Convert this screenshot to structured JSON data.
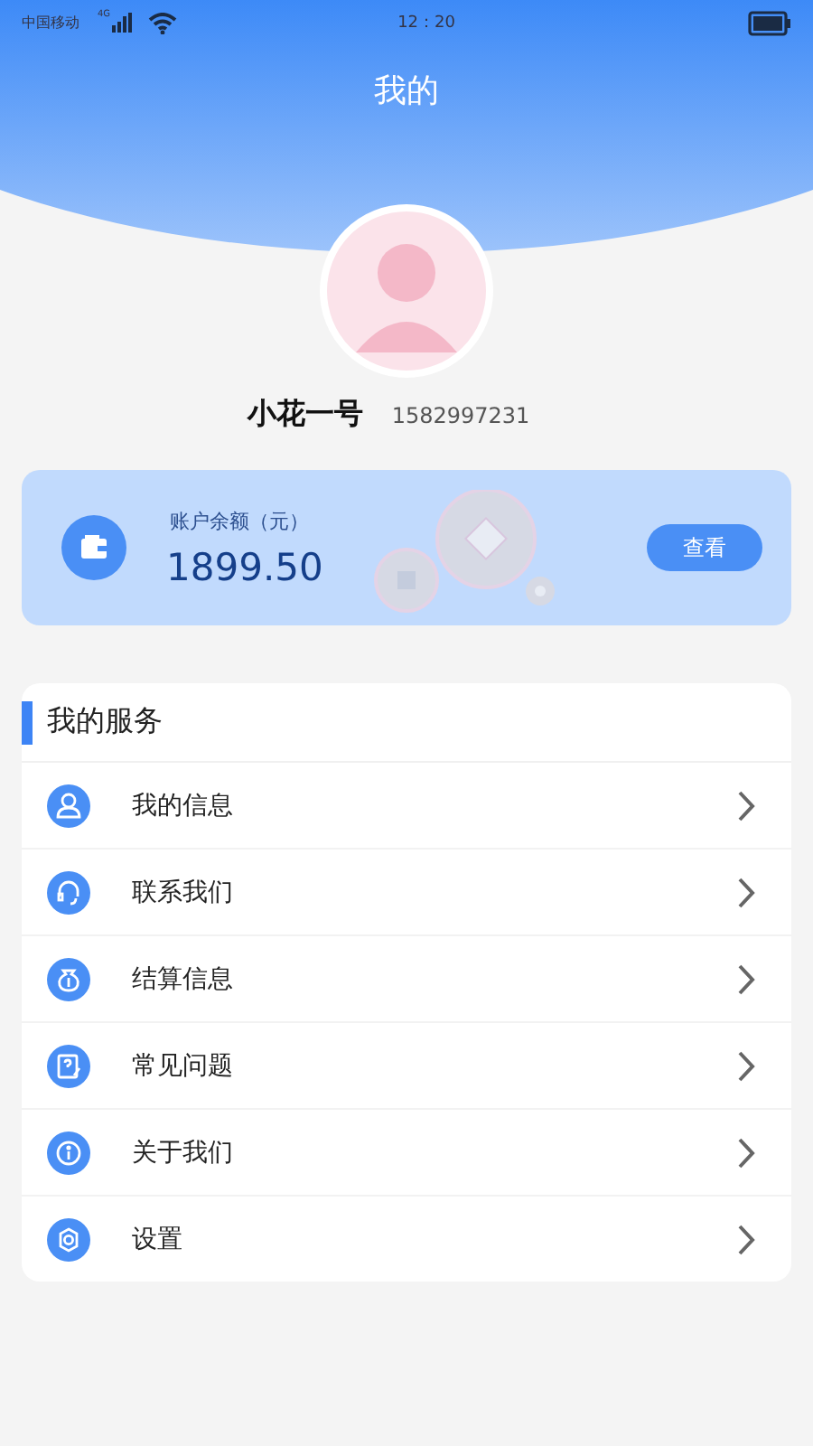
{
  "status_bar": {
    "carrier": "中国移动",
    "network": "4G",
    "time": "12：20"
  },
  "header": {
    "title": "我的"
  },
  "profile": {
    "name": "小花一号",
    "phone": "1582997231"
  },
  "balance": {
    "label": "账户余额（元）",
    "amount": "1899.50",
    "button": "查看"
  },
  "services": {
    "title": "我的服务",
    "items": [
      {
        "kind": "user",
        "label": "我的信息"
      },
      {
        "kind": "headset",
        "label": "联系我们"
      },
      {
        "kind": "moneybag",
        "label": "结算信息"
      },
      {
        "kind": "question",
        "label": "常见问题"
      },
      {
        "kind": "info",
        "label": "关于我们"
      },
      {
        "kind": "gear",
        "label": "设置"
      }
    ]
  }
}
